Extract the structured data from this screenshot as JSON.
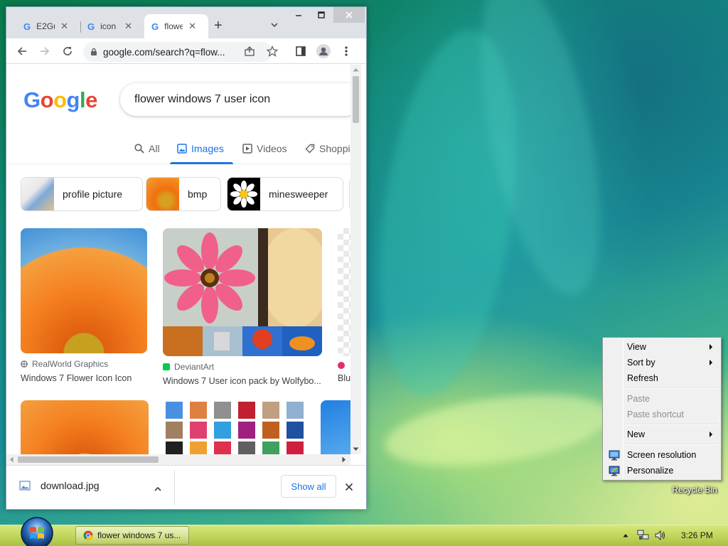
{
  "browser": {
    "tabs": [
      {
        "label": "E2Gu",
        "active": false
      },
      {
        "label": "icon",
        "active": false
      },
      {
        "label": "flowe",
        "active": true
      }
    ],
    "url": "google.com/search?q=flow...",
    "page": {
      "logo": "Google",
      "query": "flower windows 7 user icon",
      "nav_tabs": [
        "All",
        "Images",
        "Videos",
        "Shoppi"
      ],
      "active_nav_tab": "Images",
      "chips": [
        "profile picture",
        "bmp",
        "minesweeper"
      ],
      "results": [
        {
          "source": "RealWorld Graphics",
          "title": "Windows 7 Flower Icon Icon"
        },
        {
          "source": "DeviantArt",
          "title": "Windows 7 User icon pack by Wolfybo..."
        },
        {
          "source": "",
          "title": "Blu"
        }
      ]
    },
    "download": {
      "filename": "download.jpg",
      "show_all": "Show all"
    }
  },
  "context_menu": {
    "items": [
      {
        "label": "View",
        "submenu": true,
        "enabled": true
      },
      {
        "label": "Sort by",
        "submenu": true,
        "enabled": true
      },
      {
        "label": "Refresh",
        "submenu": false,
        "enabled": true
      },
      {
        "label": "Paste",
        "submenu": false,
        "enabled": false
      },
      {
        "label": "Paste shortcut",
        "submenu": false,
        "enabled": false
      },
      {
        "label": "New",
        "submenu": true,
        "enabled": true
      },
      {
        "label": "Screen resolution",
        "submenu": false,
        "enabled": true,
        "icon": "monitor-icon"
      },
      {
        "label": "Personalize",
        "submenu": false,
        "enabled": true,
        "icon": "personalize-icon"
      }
    ]
  },
  "desktop": {
    "recycle_bin_label": "Recycle Bin"
  },
  "taskbar": {
    "app_label": "flower windows 7 us...",
    "clock": "3:26 PM"
  },
  "colors": {
    "google_blue": "#4285f4",
    "google_red": "#ea4335",
    "google_yellow": "#fbbc05",
    "google_green": "#34a853",
    "link_blue": "#1a73e8"
  }
}
